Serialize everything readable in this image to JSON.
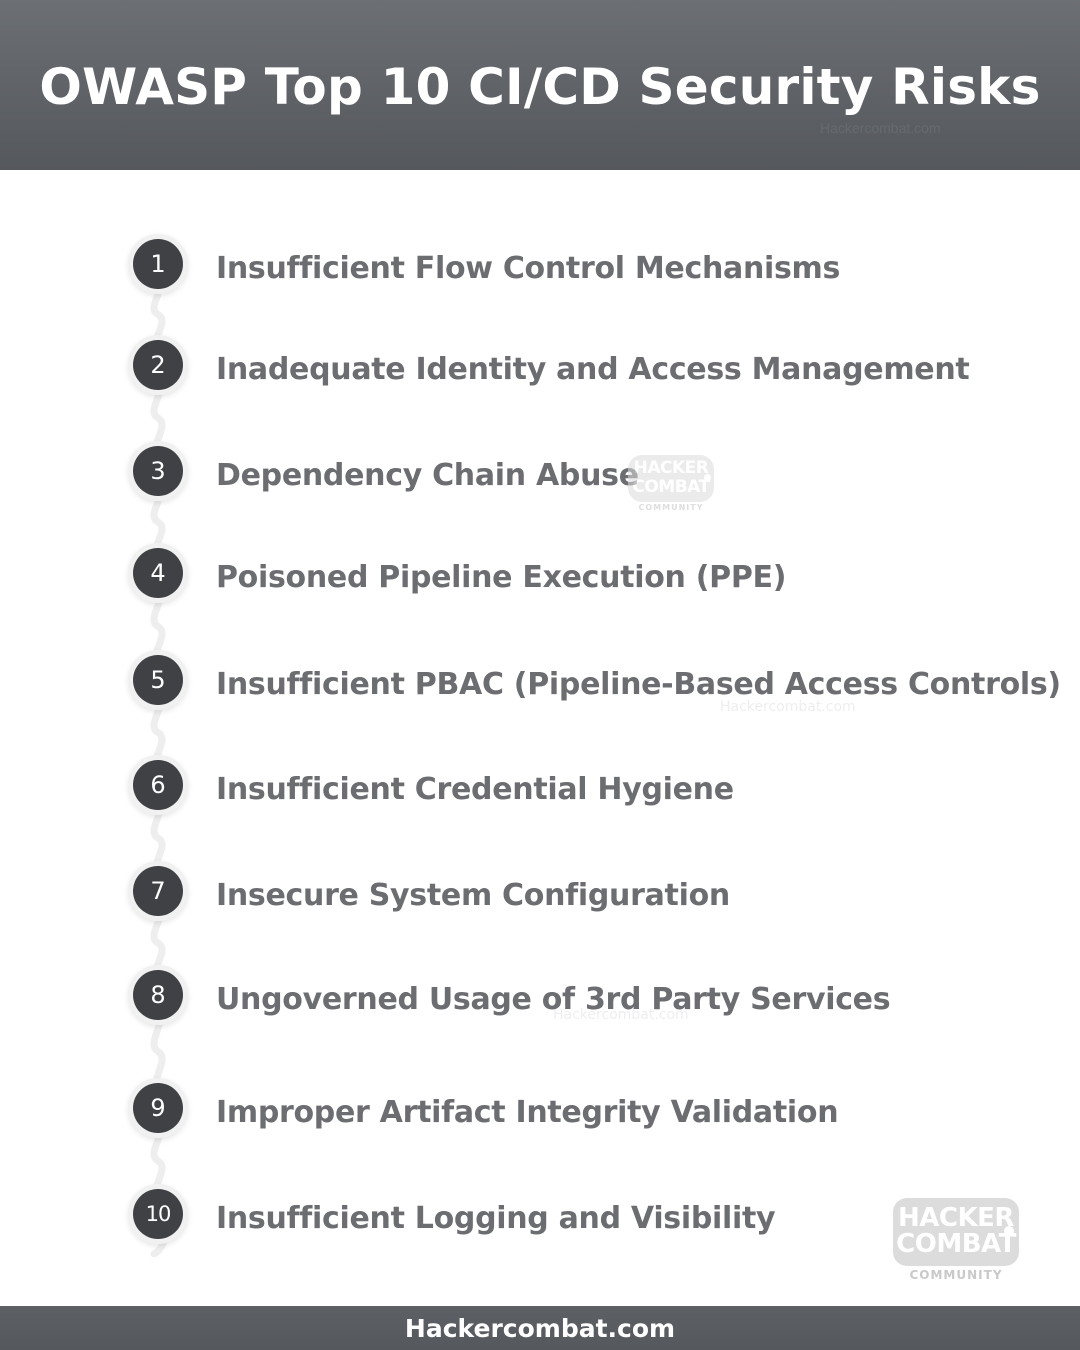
{
  "header": {
    "title": "OWASP Top 10 CI/CD Security Risks",
    "watermark": "Hackercombat.com"
  },
  "risks": [
    {
      "number": "1",
      "label": "Insufficient Flow Control Mechanisms"
    },
    {
      "number": "2",
      "label": "Inadequate Identity and Access Management"
    },
    {
      "number": "3",
      "label": "Dependency Chain Abuse"
    },
    {
      "number": "4",
      "label": "Poisoned Pipeline Execution (PPE)"
    },
    {
      "number": "5",
      "label": "Insufficient PBAC (Pipeline-Based Access Controls)"
    },
    {
      "number": "6",
      "label": "Insufficient Credential Hygiene"
    },
    {
      "number": "7",
      "label": "Insecure System Configuration"
    },
    {
      "number": "8",
      "label": "Ungoverned Usage of 3rd Party Services"
    },
    {
      "number": "9",
      "label": "Improper Artifact Integrity Validation"
    },
    {
      "number": "10",
      "label": "Insufficient Logging and Visibility"
    }
  ],
  "watermarks": [
    "Hackercombat.com",
    "Hackercombat.com"
  ],
  "logo": {
    "line1": "HACKER",
    "line2": "COMBAT",
    "tagline": "COMMUNITY"
  },
  "footer": {
    "text": "Hackercombat.com"
  },
  "colors": {
    "header_bg": "#5f6267",
    "badge_bg": "#3f4145",
    "label_text": "#6b6d71",
    "chain": "#eeeeee"
  }
}
